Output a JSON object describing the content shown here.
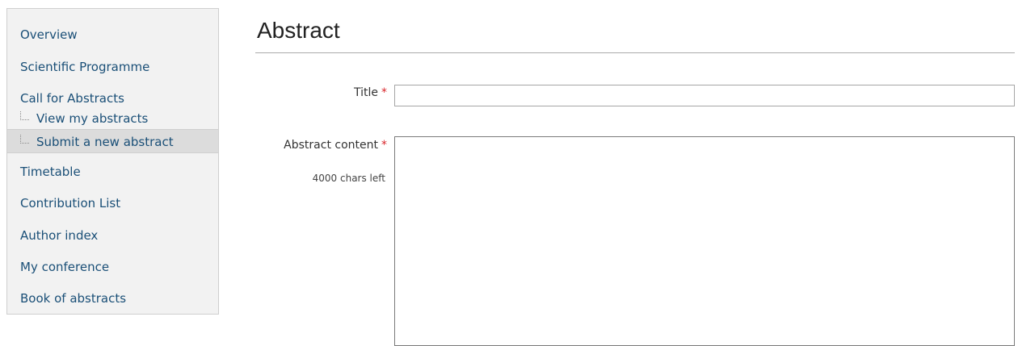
{
  "sidebar": {
    "items": [
      {
        "label": "Overview"
      },
      {
        "label": "Scientific Programme"
      },
      {
        "label": "Call for Abstracts"
      },
      {
        "label": "View my abstracts"
      },
      {
        "label": "Submit a new abstract"
      },
      {
        "label": "Timetable"
      },
      {
        "label": "Contribution List"
      },
      {
        "label": "Author index"
      },
      {
        "label": "My conference"
      },
      {
        "label": "Book of abstracts"
      }
    ]
  },
  "main": {
    "title": "Abstract",
    "form": {
      "title_field": {
        "label": "Title",
        "required_mark": "*",
        "value": "",
        "placeholder": ""
      },
      "content_field": {
        "label": "Abstract content",
        "required_mark": "*",
        "chars_left": "4000 chars left",
        "value": "",
        "placeholder": ""
      }
    }
  },
  "colors": {
    "link": "#1a4f77",
    "required": "#d9262b",
    "sidebar_bg": "#f2f2f2",
    "active_bg": "#dcdcdc"
  }
}
